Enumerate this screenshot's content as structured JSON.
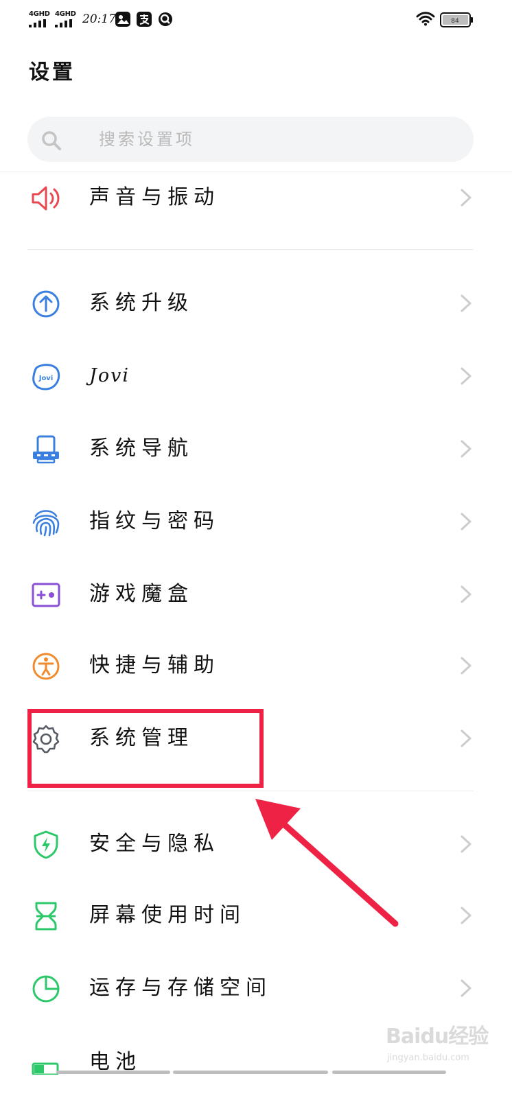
{
  "status_bar": {
    "signal_1_label": "4GHD",
    "signal_2_label": "4GHD",
    "time": "20:17",
    "battery_level": "84",
    "icons": [
      "signal-icon",
      "signal-icon",
      "gallery-icon",
      "alipay-icon",
      "app-q-icon",
      "wifi-icon",
      "battery-icon"
    ]
  },
  "header": {
    "title": "设置"
  },
  "search": {
    "value": "",
    "placeholder": "搜索设置项"
  },
  "settings": {
    "items": [
      {
        "label": "声音与振动",
        "icon": "speaker-icon",
        "color": "#e8484f"
      },
      {
        "label": "系统升级",
        "icon": "upgrade-arrow-icon",
        "color": "#3a7fe0"
      },
      {
        "label": "Jovi",
        "icon": "jovi-icon",
        "color": "#3a7fe0"
      },
      {
        "label": "系统导航",
        "icon": "navigation-icon",
        "color": "#3a7fe0"
      },
      {
        "label": "指纹与密码",
        "icon": "fingerprint-icon",
        "color": "#3a7fe0"
      },
      {
        "label": "游戏魔盒",
        "icon": "gamepad-icon",
        "color": "#8a4fd6"
      },
      {
        "label": "快捷与辅助",
        "icon": "accessibility-icon",
        "color": "#f08a2c"
      },
      {
        "label": "系统管理",
        "icon": "gear-icon",
        "color": "#555a63"
      },
      {
        "label": "安全与隐私",
        "icon": "shield-icon",
        "color": "#2cc86a"
      },
      {
        "label": "屏幕使用时间",
        "icon": "hourglass-icon",
        "color": "#2cc86a"
      },
      {
        "label": "运存与存储空间",
        "icon": "storage-pie-icon",
        "color": "#2cc86a"
      },
      {
        "label": "电池",
        "icon": "battery-setting-icon",
        "color": "#2cc86a"
      }
    ]
  },
  "annotation": {
    "highlight_color": "#ee2244"
  },
  "watermark": {
    "brand": "Baidu经验",
    "url": "jingyan.baidu.com"
  }
}
